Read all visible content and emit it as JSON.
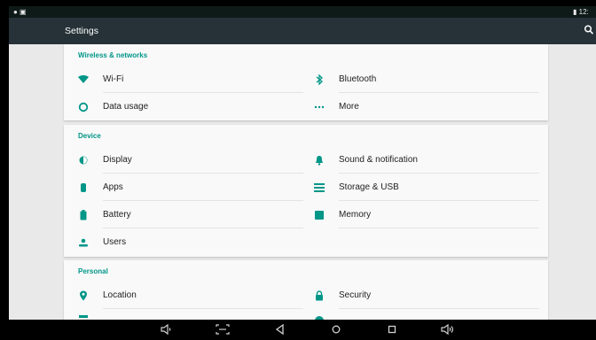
{
  "status_bar": {
    "left_icons": "● ▣",
    "right_text": "▮ 12:"
  },
  "app_bar": {
    "title": "Settings"
  },
  "sections": {
    "wireless": {
      "header": "Wireless & networks",
      "items": [
        {
          "label": "Wi-Fi",
          "icon": "wifi-icon"
        },
        {
          "label": "Bluetooth",
          "icon": "bluetooth-icon"
        },
        {
          "label": "Data usage",
          "icon": "data-usage-icon"
        },
        {
          "label": "More",
          "icon": "more-icon"
        }
      ]
    },
    "device": {
      "header": "Device",
      "items": [
        {
          "label": "Display",
          "icon": "display-icon"
        },
        {
          "label": "Sound & notification",
          "icon": "bell-icon"
        },
        {
          "label": "Apps",
          "icon": "apps-icon"
        },
        {
          "label": "Storage & USB",
          "icon": "storage-icon"
        },
        {
          "label": "Battery",
          "icon": "battery-icon"
        },
        {
          "label": "Memory",
          "icon": "memory-icon"
        },
        {
          "label": "Users",
          "icon": "users-icon"
        }
      ]
    },
    "personal": {
      "header": "Personal",
      "items": [
        {
          "label": "Location",
          "icon": "location-icon"
        },
        {
          "label": "Security",
          "icon": "lock-icon"
        }
      ]
    }
  },
  "colors": {
    "accent": "#009688",
    "app_bar": "#263238",
    "background": "#e9e9e9",
    "card": "#f9f9f9"
  },
  "nav_bar": {
    "icons": [
      "volume-down-icon",
      "screenshot-icon",
      "back-icon",
      "home-icon",
      "recents-icon",
      "volume-up-icon"
    ]
  }
}
